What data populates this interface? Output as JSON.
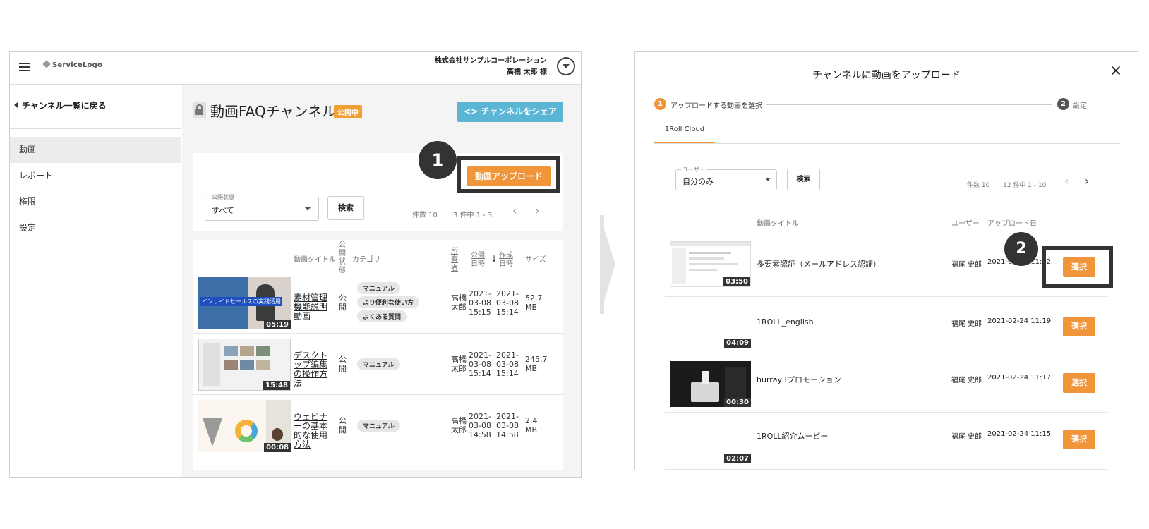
{
  "left": {
    "logo": "ServiceLogo",
    "company": "株式会社サンプルコーポレーション",
    "user_name": "高橋 太郎 様",
    "back_link": "チャンネル一覧に戻る",
    "nav": [
      "動画",
      "レポート",
      "権限",
      "設定"
    ],
    "channel_title": "動画FAQチャンネル",
    "status_badge": "公開中",
    "share_button": "チャンネルをシェア",
    "upload_button": "動画アップロード",
    "step1": "1",
    "filter": {
      "label": "公開状態",
      "value": "すべて",
      "search_button": "検索",
      "per_page": "件数 10",
      "range": "3 件中 1 - 3"
    },
    "table": {
      "headers": {
        "title": "動画タイトル",
        "status": "公開状態",
        "category": "カテゴリ",
        "owner": "所有者",
        "published": "公開日時",
        "created": "作成日時",
        "size": "サイズ"
      },
      "rows": [
        {
          "title": "素材管理機能説明動画",
          "status": "公開",
          "tags": [
            "マニュアル",
            "より便利な使い方",
            "よくある質問"
          ],
          "owner": "高橋太郎",
          "published": "2021-03-08 15:15",
          "created": "2021-03-08 15:14",
          "size": "52.7 MB",
          "duration": "05:19",
          "thumb_text": "インサイドセールスの実践活用"
        },
        {
          "title": "デスクトップ編集の操作方法",
          "status": "公開",
          "tags": [
            "マニュアル"
          ],
          "owner": "高橋太郎",
          "published": "2021-03-08 15:14",
          "created": "2021-03-08 15:14",
          "size": "245.7 MB",
          "duration": "15:48"
        },
        {
          "title": "ウェビナーの基本的な使用方法",
          "status": "公開",
          "tags": [
            "マニュアル"
          ],
          "owner": "高橋太郎",
          "published": "2021-03-08 14:58",
          "created": "2021-03-08 14:58",
          "size": "2.4 MB",
          "duration": "00:08"
        }
      ]
    }
  },
  "modal": {
    "title": "チャンネルに動画をアップロード",
    "steps": [
      {
        "num": "1",
        "label": "アップロードする動画を選択"
      },
      {
        "num": "2",
        "label": "設定"
      }
    ],
    "tab": "1Roll Cloud",
    "user_filter": {
      "label": "ユーザー",
      "value": "自分のみ"
    },
    "search_button": "検索",
    "per_page": "件数 10",
    "range": "12 件中 1 - 10",
    "headers": {
      "title": "動画タイトル",
      "user": "ユーザー",
      "uploaded": "アップロード日"
    },
    "step2": "2",
    "select_label": "選択",
    "rows": [
      {
        "title": "多要素認証（メールアドレス認証）",
        "user": "福尾 史郎",
        "date": "2021-02-24 11:22",
        "duration": "03:50"
      },
      {
        "title": "1ROLL_english",
        "user": "福尾 史郎",
        "date": "2021-02-24 11:19",
        "duration": "04:09"
      },
      {
        "title": "hurray3プロモーション",
        "user": "福尾 史郎",
        "date": "2021-02-24 11:17",
        "duration": "00:30"
      },
      {
        "title": "1ROLL紹介ムービー",
        "user": "福尾 史郎",
        "date": "2021-02-24 11:15",
        "duration": "02:07"
      }
    ]
  },
  "colors": {
    "accent": "#f0953a",
    "share": "#5bb6d6",
    "badge": "#f0a035",
    "dark": "#333333"
  }
}
